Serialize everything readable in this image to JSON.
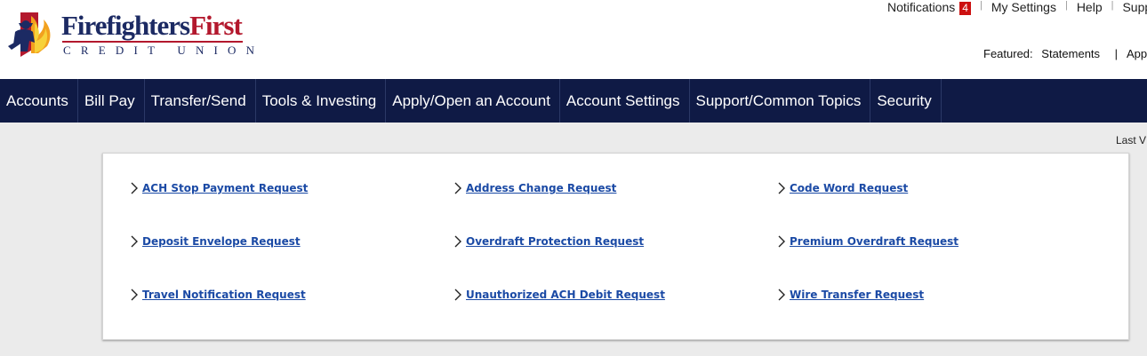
{
  "brand": {
    "name_part1": "Firefighters",
    "name_part2": "First",
    "subtitle": "CREDIT UNION"
  },
  "utility": {
    "notifications_label": "Notifications",
    "notifications_count": "4",
    "settings_label": "My Settings",
    "help_label": "Help",
    "support_label": "Supp"
  },
  "featured": {
    "label": "Featured:",
    "statements": "Statements",
    "apply": "Apply"
  },
  "nav": {
    "items": [
      {
        "label": "Accounts"
      },
      {
        "label": "Bill Pay"
      },
      {
        "label": "Transfer/Send"
      },
      {
        "label": "Tools & Investing"
      },
      {
        "label": "Apply/Open an Account"
      },
      {
        "label": "Account Settings"
      },
      {
        "label": "Support/Common Topics"
      },
      {
        "label": "Security"
      }
    ]
  },
  "last_visit": "Last V",
  "requests": [
    {
      "label": "ACH Stop Payment Request"
    },
    {
      "label": "Address Change Request"
    },
    {
      "label": "Code Word Request"
    },
    {
      "label": "Deposit Envelope Request"
    },
    {
      "label": "Overdraft Protection Request"
    },
    {
      "label": "Premium Overdraft Request"
    },
    {
      "label": "Travel Notification Request"
    },
    {
      "label": "Unauthorized ACH Debit Request"
    },
    {
      "label": "Wire Transfer Request"
    }
  ],
  "colors": {
    "nav_bg": "#0f1a45",
    "brand_navy": "#1c2a63",
    "brand_red": "#b3182d",
    "link": "#1b4aa5",
    "badge": "#cc1111"
  }
}
